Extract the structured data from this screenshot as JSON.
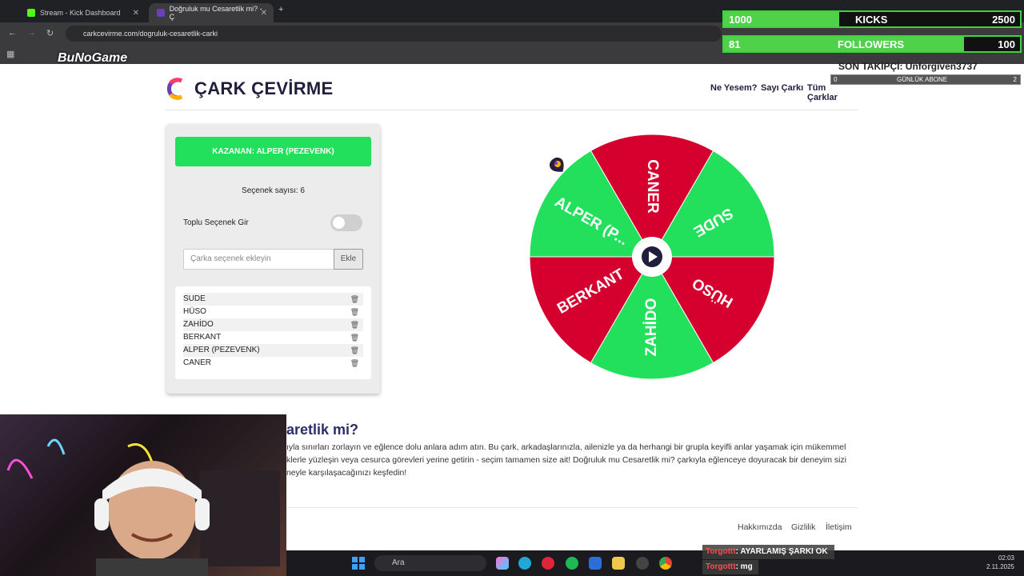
{
  "browser": {
    "tabs": [
      {
        "title": "Stream - Kick Dashboard"
      },
      {
        "title": "Doğruluk mu Cesaretlik mi? - Ç"
      }
    ],
    "url": "carkcevirme.com/dogruluk-cesaretlik-carki",
    "overlay_logo": "BuNoGame"
  },
  "site": {
    "brand": "ÇARK ÇEVİRME",
    "nav": [
      "Ne Yesem?",
      "Sayı Çarkı",
      "Tüm Çarklar"
    ],
    "brand_color": "#1f1f3d"
  },
  "panel": {
    "winner_label": "KAZANAN: ALPER (PEZEVENK)",
    "option_count": "Seçenek sayısı: 6",
    "bulk_label": "Toplu Seçenek Gir",
    "bulk_enabled": false,
    "input_placeholder": "Çarka seçenek ekleyin",
    "add_label": "Ekle",
    "options": [
      "SUDE",
      "HÜSO",
      "ZAHİDO",
      "BERKANT",
      "ALPER (PEZEVENK)",
      "CANER"
    ]
  },
  "wheel": {
    "segments": [
      {
        "label": "CANER",
        "color": "#d6002e"
      },
      {
        "label": "SUDE",
        "color": "#22e05b"
      },
      {
        "label": "HÜSO",
        "color": "#d6002e"
      },
      {
        "label": "ZAHİDO",
        "color": "#22e05b"
      },
      {
        "label": "BERKANT",
        "color": "#d6002e"
      },
      {
        "label": "ALPER (P...",
        "color": "#22e05b"
      }
    ]
  },
  "description": {
    "title": "aretlik mi?",
    "text": "ıyla sınırları zorlayın ve eğlence dolu anlara adım atın. Bu çark, arkadaşlarınızla, ailenizle ya da herhangi bir grupla keyifli anlar yaşamak için mükemmel klerle yüzleşin veya cesurca görevleri yerine getirin - seçim tamamen size ait! Doğruluk mu Cesaretlik mi? çarkıyla eğlenceye doyuracak bir deneyim sizi neyle karşılaşacağınızı keşfedin!"
  },
  "footer": {
    "links": [
      "Hakkımızda",
      "Gizlilik",
      "İletişim"
    ]
  },
  "overlay": {
    "kicks": {
      "current": "1000",
      "label": "KICKS",
      "goal": "2500",
      "progress": 0.39
    },
    "followers": {
      "current": "81",
      "label": "FOLLOWERS",
      "goal": "100",
      "progress": 0.81
    },
    "last_follower": "SON TAKİPÇİ: Unforgiven3737",
    "daily_sub": {
      "current": "0",
      "label": "GÜNLÜK ABONE",
      "goal": "2"
    },
    "chat": [
      {
        "user": "Torgottt",
        "message": ": AYARLAMIŞ ŞARKI OK"
      },
      {
        "user": "Torgottt",
        "message": ": mg"
      }
    ]
  },
  "taskbar": {
    "search_placeholder": "Ara",
    "time": "02:03",
    "date": "2.11.2025"
  }
}
